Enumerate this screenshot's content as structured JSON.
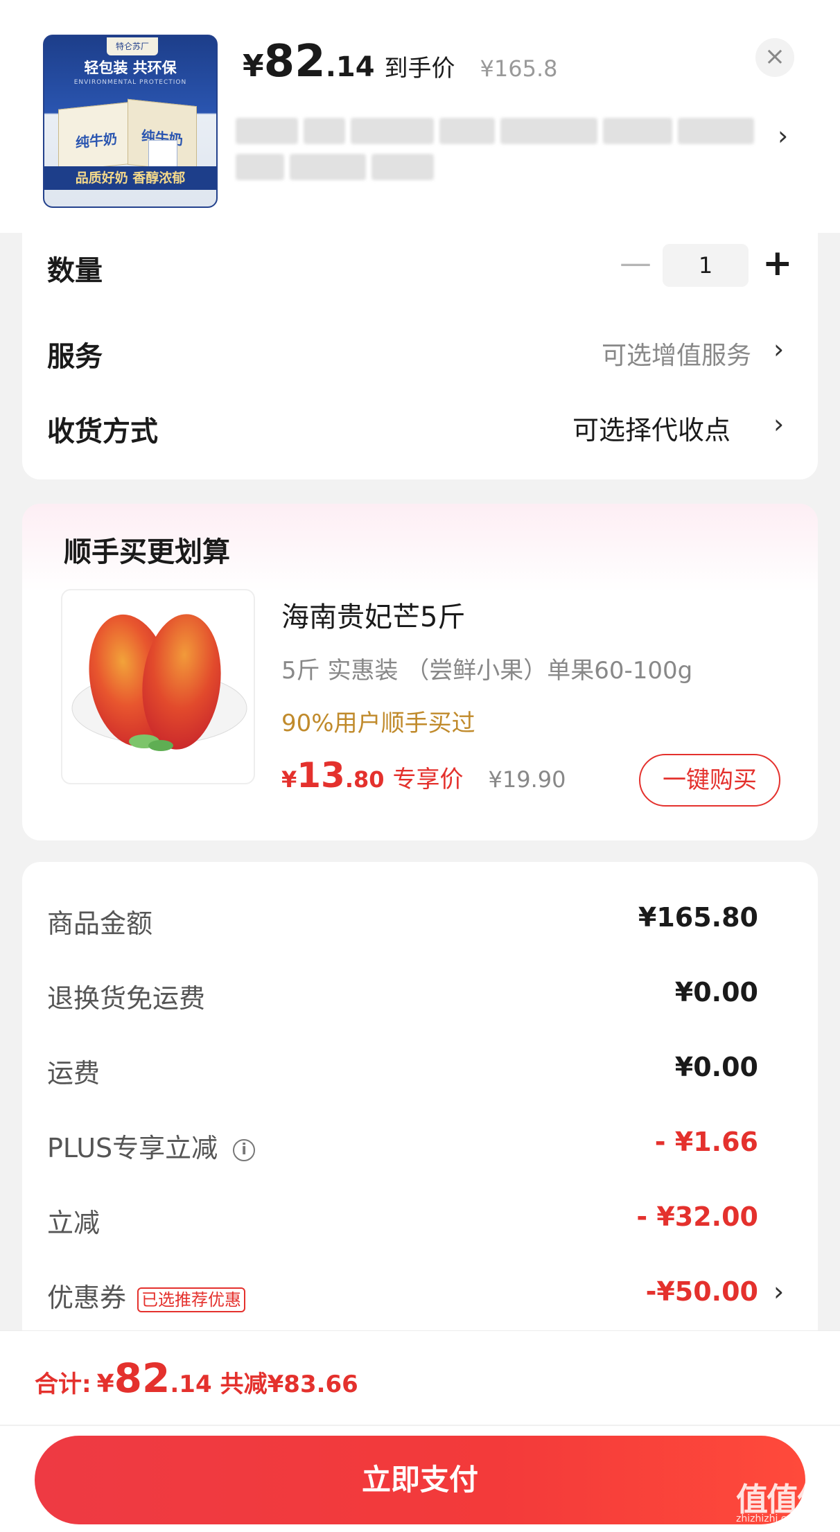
{
  "product": {
    "price_symbol": "¥",
    "price_int": "82",
    "price_dec": ".14",
    "price_tag": "到手价",
    "original_price": "¥165.8",
    "thumb": {
      "brand": "特仑苏厂",
      "slogan": "轻包装 共环保",
      "slogan_en": "ENVIRONMENTAL PROTECTION",
      "box_label": "纯牛奶",
      "quality": "品质好奶 香醇浓郁"
    },
    "title_blurred": true,
    "close_icon": "close-icon",
    "title_arrow": "›"
  },
  "options": {
    "quantity_label": "数量",
    "quantity_value": "1",
    "minus_symbol": "—",
    "plus_symbol": "+",
    "service_label": "服务",
    "service_value": "可选增值服务",
    "delivery_label": "收货方式",
    "delivery_value": "可选择代收点",
    "chevron": "›"
  },
  "upsell": {
    "title": "顺手买更划算",
    "item_name": "海南贵妃芒5斤",
    "item_spec": "5斤 实惠装 （尝鲜小果）单果60-100g",
    "popular": "90%用户顺手买过",
    "price_symbol": "¥",
    "price_int": "13",
    "price_dec": ".80",
    "price_tag": "专享价",
    "original_price": "¥19.90",
    "buy_label": "一键购买"
  },
  "summary": {
    "rows": [
      {
        "label": "商品金额",
        "value": "¥165.80",
        "red": false
      },
      {
        "label": "退换货免运费",
        "value": "¥0.00",
        "red": false
      },
      {
        "label": "运费",
        "value": "¥0.00",
        "red": false
      },
      {
        "label": "PLUS专享立减",
        "value": "- ¥1.66",
        "red": true
      },
      {
        "label": "立减",
        "value": "- ¥32.00",
        "red": true
      },
      {
        "label": "优惠券",
        "value": "-¥50.00",
        "red": true
      }
    ],
    "info_icon": "i",
    "coupon_badge": "已选推荐优惠",
    "chevron": "›"
  },
  "footer": {
    "total_label": "合计:",
    "total_symbol": "¥",
    "total_int": "82",
    "total_dec": ".14",
    "saved": "共减¥83.66",
    "pay_label": "立即支付",
    "watermark": "值值值",
    "watermark_sub": "zhizhizhi.com"
  },
  "colors": {
    "accent_red": "#e4312d",
    "gold": "#c08a2b",
    "background": "#f2f2f2"
  }
}
